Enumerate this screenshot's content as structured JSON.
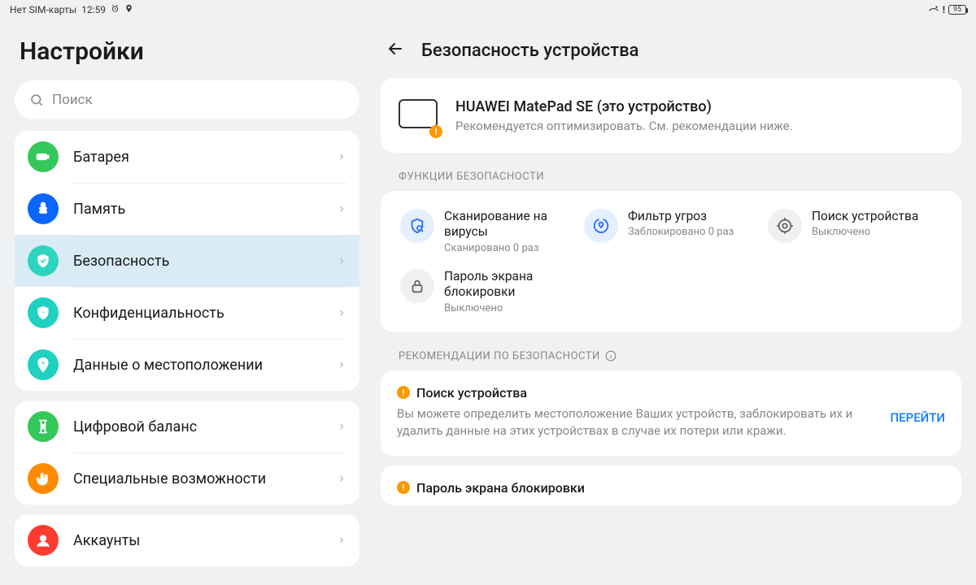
{
  "status": {
    "sim": "Нет SIM-карты",
    "time": "12:59",
    "battery": "95"
  },
  "left": {
    "title": "Настройки",
    "search_placeholder": "Поиск",
    "groups": [
      {
        "items": [
          {
            "key": "battery",
            "label": "Батарея",
            "color": "#34c759",
            "icon": "battery"
          },
          {
            "key": "storage",
            "label": "Память",
            "color": "#0a66ff",
            "icon": "storage"
          },
          {
            "key": "security",
            "label": "Безопасность",
            "color": "#2dd4bf",
            "icon": "shield",
            "selected": true
          },
          {
            "key": "privacy",
            "label": "Конфиденциальность",
            "color": "#1fd1c1",
            "icon": "shield-eye"
          },
          {
            "key": "location",
            "label": "Данные о местоположении",
            "color": "#1fd1c1",
            "icon": "pin"
          }
        ]
      },
      {
        "items": [
          {
            "key": "digital",
            "label": "Цифровой баланс",
            "color": "#34c759",
            "icon": "hourglass"
          },
          {
            "key": "accessibility",
            "label": "Специальные возможности",
            "color": "#ff8a00",
            "icon": "hand"
          }
        ]
      },
      {
        "items": [
          {
            "key": "accounts",
            "label": "Аккаунты",
            "color": "#ff3b30",
            "icon": "user"
          }
        ]
      }
    ]
  },
  "right": {
    "title": "Безопасность устройства",
    "device": {
      "name": "HUAWEI MatePad SE (это устройство)",
      "sub": "Рекомендуется оптимизировать. См. рекомендации ниже."
    },
    "features_label": "ФУНКЦИИ БЕЗОПАСНОСТИ",
    "features": [
      {
        "key": "virus",
        "title": "Сканирование на вирусы",
        "sub": "Сканировано 0 раз",
        "bg": "#e4efff",
        "fg": "#2b6cff"
      },
      {
        "key": "threat",
        "title": "Фильтр угроз",
        "sub": "Заблокировано 0 раз",
        "bg": "#e4efff",
        "fg": "#2b6cff"
      },
      {
        "key": "find",
        "title": "Поиск устройства",
        "sub": "Выключено",
        "bg": "#f0f0f2",
        "fg": "#666"
      },
      {
        "key": "lockpw",
        "title": "Пароль экрана блокировки",
        "sub": "Выключено",
        "bg": "#f0f0f2",
        "fg": "#666"
      }
    ],
    "recs_label": "РЕКОМЕНДАЦИИ ПО БЕЗОПАСНОСТИ",
    "recs": [
      {
        "title": "Поиск устройства",
        "desc": "Вы можете определить местоположение Ваших устройств, заблокировать их и удалить данные на этих устройствах в случае их потери или кражи.",
        "action": "ПЕРЕЙТИ"
      },
      {
        "title": "Пароль экрана блокировки"
      }
    ]
  }
}
